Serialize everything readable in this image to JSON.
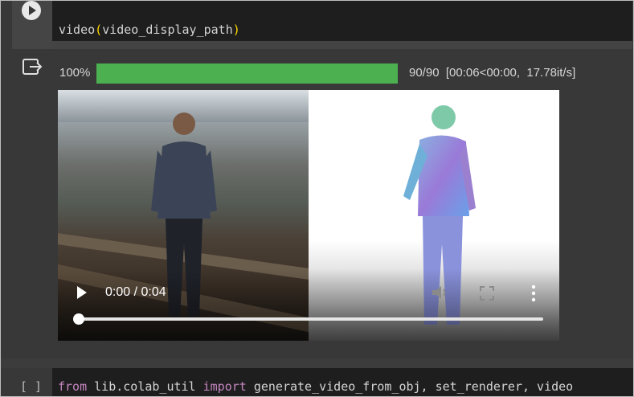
{
  "cell1": {
    "run_icon": "play-circle-icon",
    "code": {
      "func": "video",
      "open_paren": "(",
      "arg": "video_display_path",
      "close_paren": ")"
    }
  },
  "output": {
    "icon": "output-redirect-icon",
    "progress": {
      "percent_text": "100%",
      "fraction": 1.0,
      "stats": "90/90  [00:06<00:00,  17.78it/s]",
      "bar_color": "#4caf50"
    },
    "video": {
      "time": "0:00 / 0:04",
      "playback_position": 0.0,
      "play_icon": "play-icon",
      "volume_icon": "volume-icon",
      "fullscreen_icon": "fullscreen-icon",
      "more_icon": "more-vertical-icon"
    }
  },
  "cell2": {
    "brackets": "[ ]",
    "code": {
      "kw_from": "from",
      "module": " lib.colab_util ",
      "kw_import": "import",
      "names": " generate_video_from_obj, set_renderer, video"
    }
  }
}
